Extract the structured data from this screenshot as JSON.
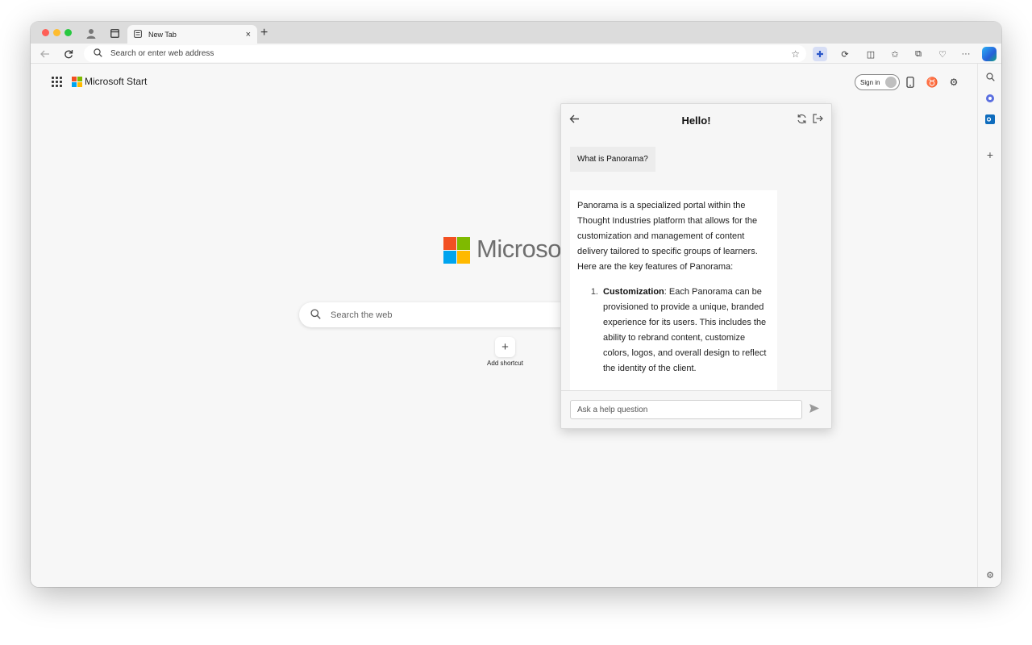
{
  "browser": {
    "tab": {
      "title": "New Tab",
      "close": "×"
    },
    "new_tab_symbol": "+",
    "address_placeholder": "Search or enter web address",
    "more_symbol": "···"
  },
  "newtab_page": {
    "brand": "Microsoft Start",
    "wordmark": "Microsoft",
    "search_placeholder": "Search the web",
    "shortcut_symbol": "+",
    "add_shortcut_label": "Add shortcut",
    "sign_in_label": "Sign in"
  },
  "help_panel": {
    "title": "Hello!",
    "user_question": "What is Panorama?",
    "answer_intro": "Panorama is a specialized portal within the Thought Industries platform that allows for the customization and management of content delivery tailored to specific groups of learners. Here are the key features of Panorama:",
    "list_items": [
      {
        "number": "1.",
        "term": "Customization",
        "text": ": Each Panorama can be provisioned to provide a unique, branded experience for its users. This includes the ability to rebrand content, customize colors, logos, and overall design to reflect the identity of the client."
      }
    ],
    "input_placeholder": "Ask a help question"
  },
  "colors": {
    "accent": "#2b57c8",
    "ms_red": "#f25022",
    "ms_green": "#7fba00",
    "ms_blue": "#00a4ef",
    "ms_yellow": "#ffb900"
  }
}
